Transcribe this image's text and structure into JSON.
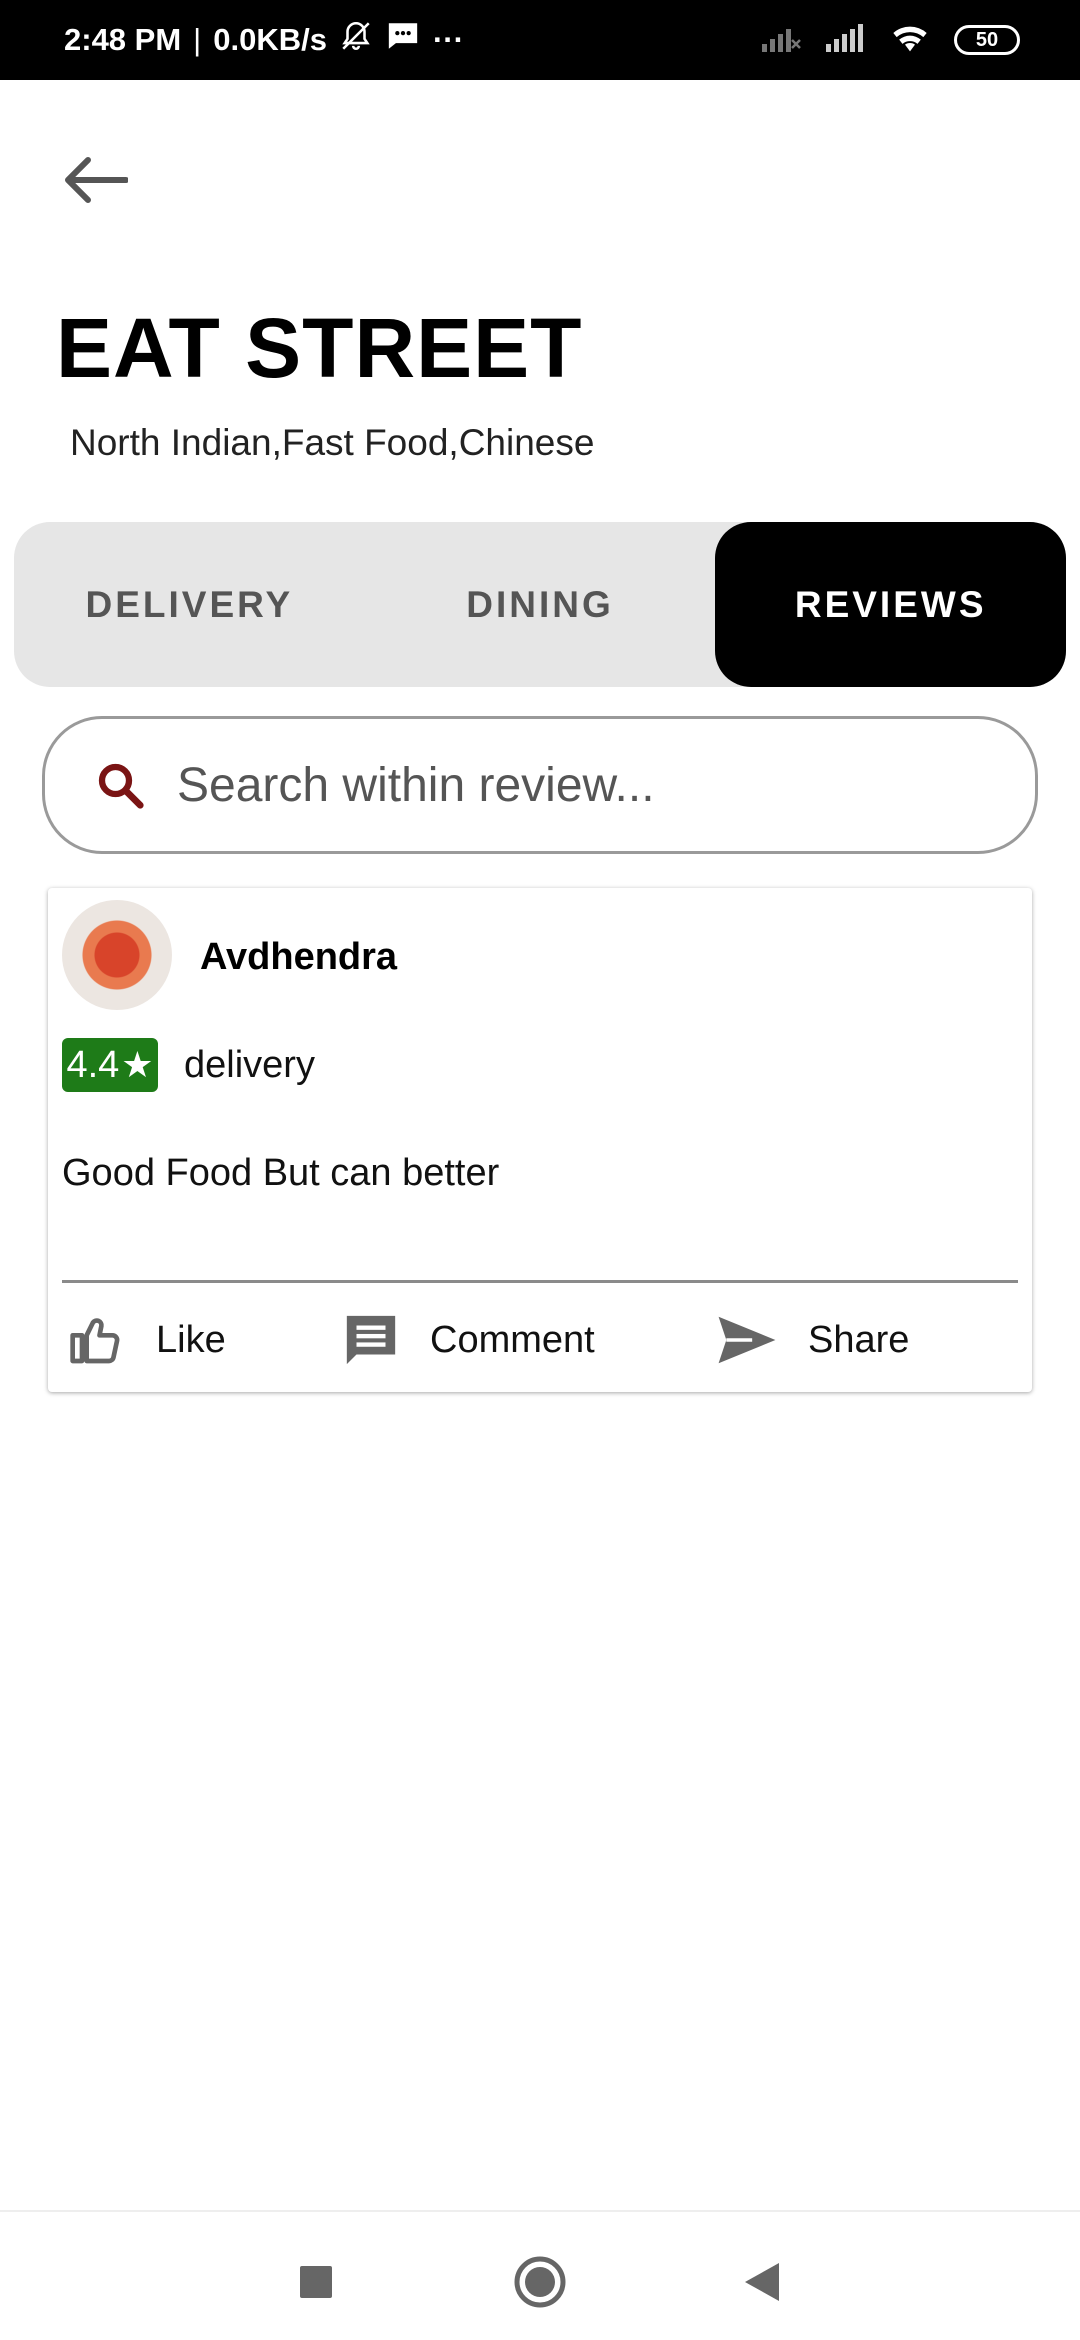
{
  "status_bar": {
    "time": "2:48 PM",
    "separator": "|",
    "network_speed": "0.0KB/s",
    "more": "···",
    "battery": "50",
    "icons": [
      "bell-off-icon",
      "message-icon",
      "signal-icon",
      "signal-icon",
      "wifi-icon",
      "battery-icon"
    ]
  },
  "header": {
    "back_icon": "arrow-left-icon",
    "title": "EAT STREET",
    "cuisines": "North Indian,Fast Food,Chinese"
  },
  "tabs": [
    {
      "label": "DELIVERY",
      "active": false
    },
    {
      "label": "DINING",
      "active": false
    },
    {
      "label": "REVIEWS",
      "active": true
    }
  ],
  "search": {
    "placeholder": "Search within review...",
    "icon": "search-icon",
    "icon_color": "#7a1414"
  },
  "review": {
    "reviewer": "Avdhendra",
    "rating": "4.4",
    "rating_color": "#1e7b18",
    "type": "delivery",
    "text": "Good Food But can better",
    "actions": {
      "like": "Like",
      "comment": "Comment",
      "share": "Share"
    }
  },
  "nav_bar": {
    "icons": [
      "recents-icon",
      "home-icon",
      "back-icon"
    ]
  }
}
